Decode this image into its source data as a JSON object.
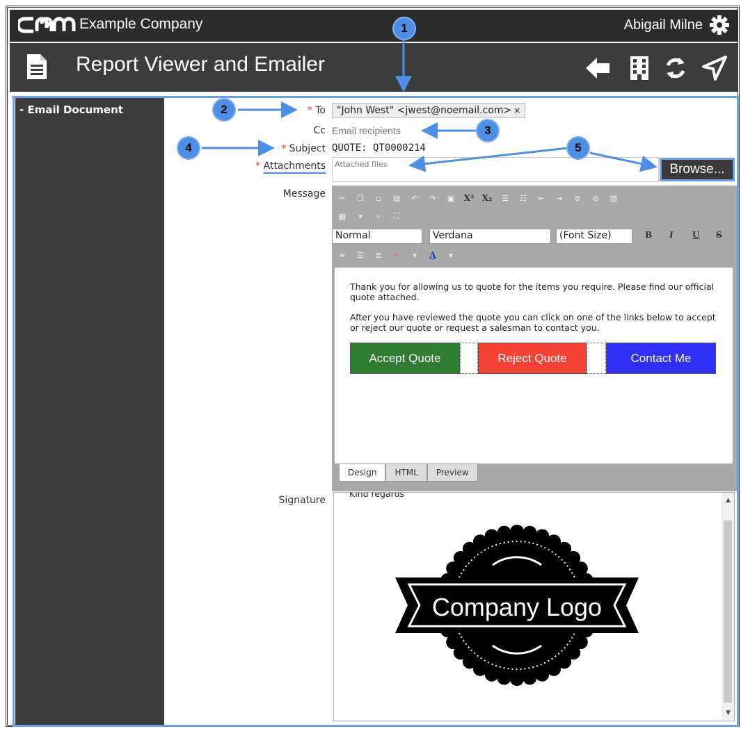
{
  "header": {
    "logo_text": "CRM",
    "company": "Example Company",
    "user": "Abigail Milne",
    "page_title": "Report Viewer and Emailer"
  },
  "sidebar": {
    "items": [
      {
        "label": "- Email Document"
      }
    ]
  },
  "form": {
    "to_label": "To",
    "to_value": "\"John West\" <jwest@noemail.com>",
    "to_remove": "×",
    "cc_label": "Cc",
    "cc_placeholder": "Email recipients",
    "subject_label": "Subject",
    "subject_value": "QUOTE: QT0000214",
    "attachments_label": "Attachments",
    "attachments_placeholder": "Attached files",
    "browse_label": "Browse...",
    "message_label": "Message",
    "signature_label": "Signature",
    "required_mark": "*"
  },
  "editor": {
    "style_select": "Normal",
    "font_select": "Verdana",
    "size_select": "(Font Size)",
    "format_buttons": [
      "B",
      "I",
      "U",
      "S"
    ],
    "message_paragraphs": [
      "Thank you for allowing us to quote for the items you require. Please find our official quote attached.",
      "After you have reviewed the quote you can click on one of the links below to accept or reject our quote or request a salesman to contact you."
    ],
    "quote_buttons": [
      {
        "label": "Accept Quote",
        "color": "#2e7d32"
      },
      {
        "label": "Reject Quote",
        "color": "#f44336"
      },
      {
        "label": "Contact Me",
        "color": "#2f2ff5"
      }
    ],
    "tabs": [
      "Design",
      "HTML",
      "Preview"
    ],
    "active_tab": "Design"
  },
  "signature": {
    "text": "Kind regards",
    "logo_text": "Company Logo"
  },
  "callouts": [
    "1",
    "2",
    "3",
    "4",
    "5"
  ],
  "colors": {
    "callout": "#4e8fe6",
    "header_dark": "#2c2c2c",
    "title_bar": "#3c3c3c",
    "required": "#e0393e"
  }
}
